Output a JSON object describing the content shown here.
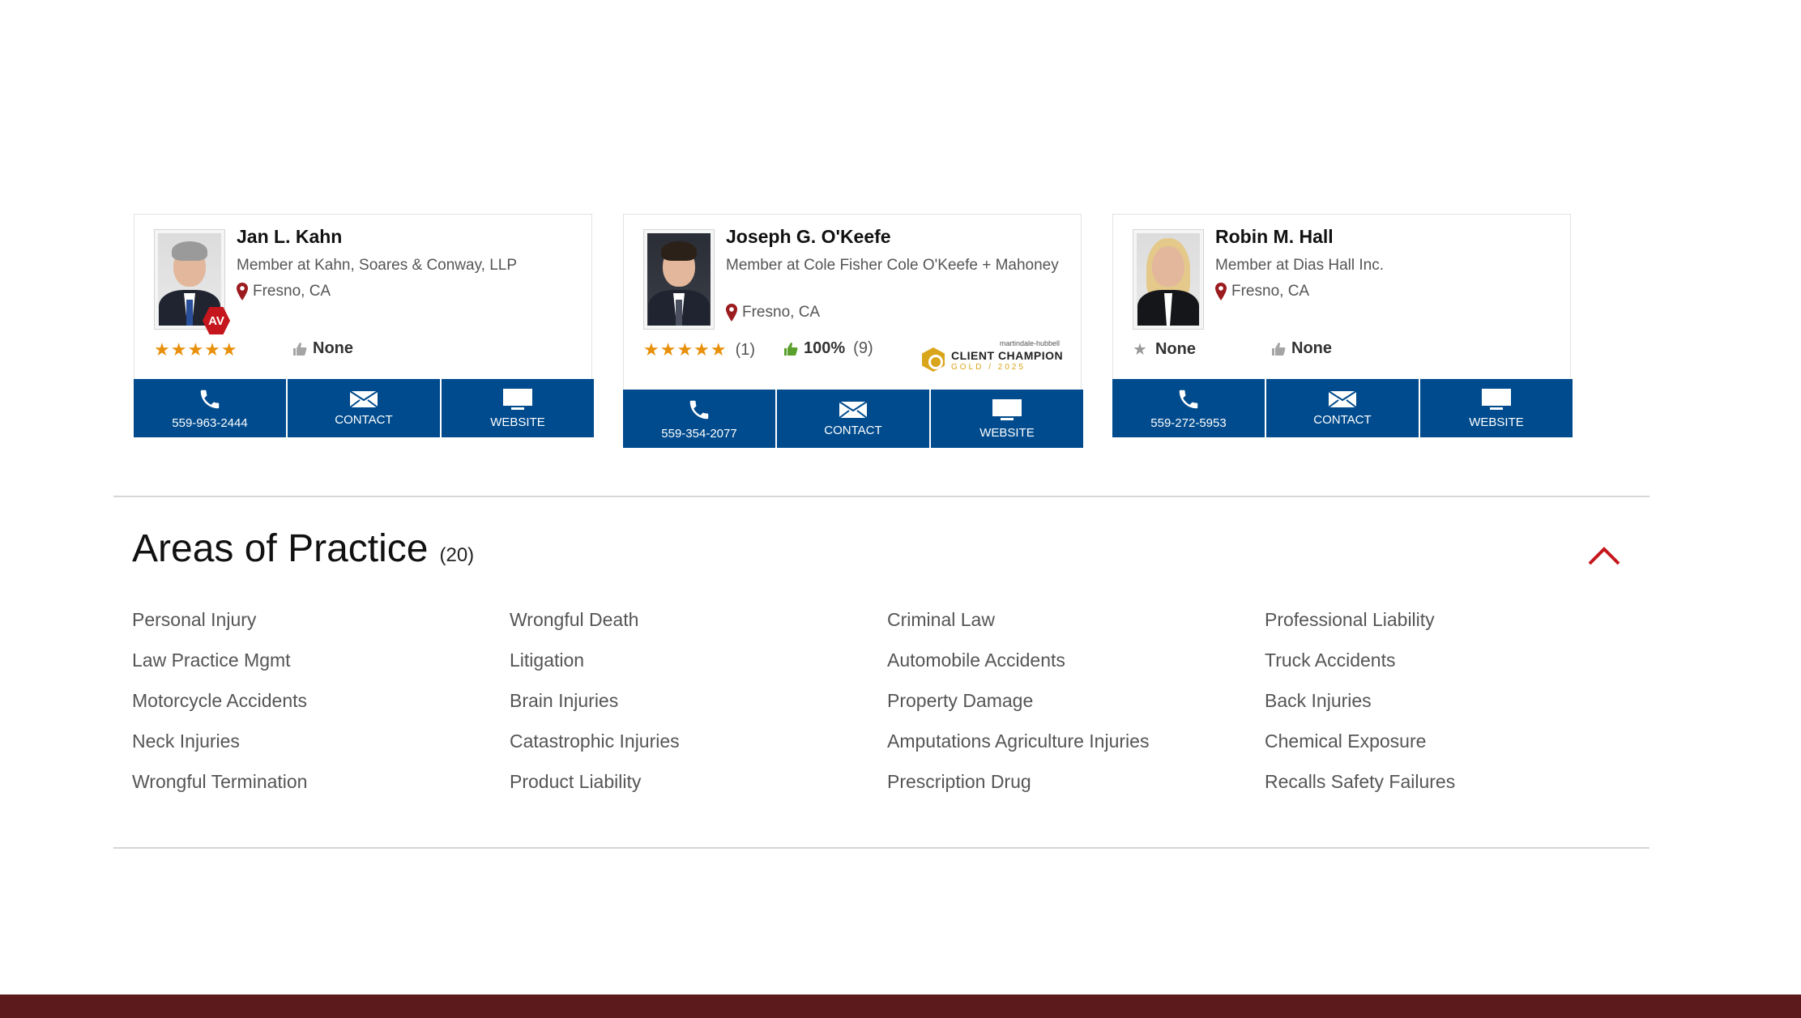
{
  "lawyers": [
    {
      "name": "Jan L. Kahn",
      "position": "Member at Kahn, Soares & Conway, LLP",
      "location": "Fresno, CA",
      "badge": "AV",
      "stars": "★★★★★",
      "peer_review": "None",
      "phone": "559-963-2444",
      "contact_label": "CONTACT",
      "website_label": "WEBSITE"
    },
    {
      "name": "Joseph G. O'Keefe",
      "position": "Member at Cole Fisher Cole O'Keefe + Mahoney",
      "location": "Fresno, CA",
      "stars": "★★★★★",
      "review_count": "(1)",
      "peer_percent": "100%",
      "peer_count": "(9)",
      "award": {
        "brand": "martindale-hubbell",
        "title": "CLIENT CHAMPION",
        "subtitle": "GOLD / 2025"
      },
      "phone": "559-354-2077",
      "contact_label": "CONTACT",
      "website_label": "WEBSITE"
    },
    {
      "name": "Robin M. Hall",
      "position": "Member at Dias Hall Inc.",
      "location": "Fresno, CA",
      "star_rating": "None",
      "peer_review": "None",
      "phone": "559-272-5953",
      "contact_label": "CONTACT",
      "website_label": "WEBSITE"
    }
  ],
  "practice": {
    "title": "Areas of Practice",
    "count": "(20)",
    "items": [
      "Personal Injury",
      "Wrongful Death",
      "Criminal Law",
      "Professional Liability",
      "Law Practice Mgmt",
      "Litigation",
      "Automobile Accidents",
      "Truck Accidents",
      "Motorcycle Accidents",
      "Brain Injuries",
      "Property Damage",
      "Back Injuries",
      "Neck Injuries",
      "Catastrophic Injuries",
      "Amputations Agriculture Injuries",
      "Chemical Exposure",
      "Wrongful Termination",
      "Product Liability",
      "Prescription Drug",
      "Recalls Safety Failures"
    ]
  },
  "colors": {
    "action_blue": "#004b8d",
    "accent_red": "#c4161c",
    "footer": "#5c1a1d",
    "star_orange": "#e8900a",
    "thumb_green": "#5aa02c"
  }
}
